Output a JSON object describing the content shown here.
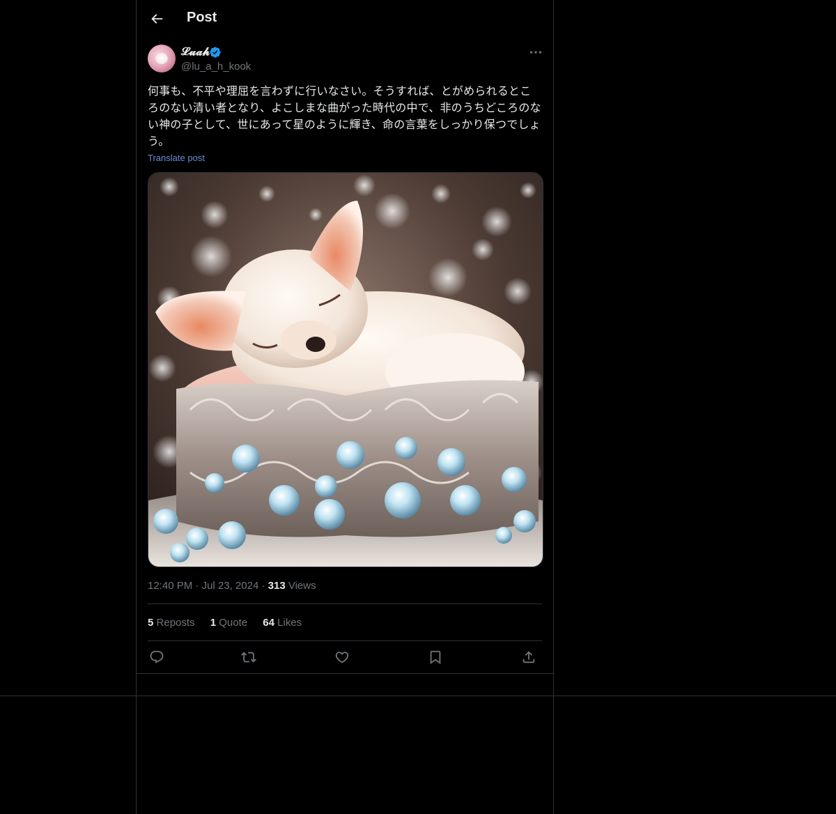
{
  "header": {
    "title": "Post"
  },
  "author": {
    "display_name": "𝓛𝓾𝓪𝓱",
    "handle": "@lu_a_h_kook",
    "verified": true
  },
  "post": {
    "text": "何事も、不平や理屈を言わずに行いなさい。そうすれば、とがめられるところのない清い者となり、よこしまな曲がった時代の中で、非のうちどころのない神の子として、世にあって星のように輝き、命の言葉をしっかり保つでしょう。",
    "translate_label": "Translate post",
    "image_alt": "Image"
  },
  "meta": {
    "time": "12:40 PM",
    "dot1": "·",
    "date": "Jul 23, 2024",
    "dot2": "·",
    "views_count": "313",
    "views_label": "Views"
  },
  "stats": {
    "reposts_count": "5",
    "reposts_label": "Reposts",
    "quotes_count": "1",
    "quotes_label": "Quote",
    "likes_count": "64",
    "likes_label": "Likes"
  },
  "icons": {
    "back": "arrow-left-icon",
    "more": "more-horizontal-icon",
    "verified": "verified-badge-icon",
    "reply": "reply-icon",
    "repost": "repost-icon",
    "like": "heart-icon",
    "bookmark": "bookmark-icon",
    "share": "share-icon"
  },
  "colors": {
    "background": "#000000",
    "text": "#e7e9ea",
    "muted": "#71767b",
    "link": "#6a8fd8",
    "border": "#2f3336",
    "verified": "#1d9bf0"
  }
}
